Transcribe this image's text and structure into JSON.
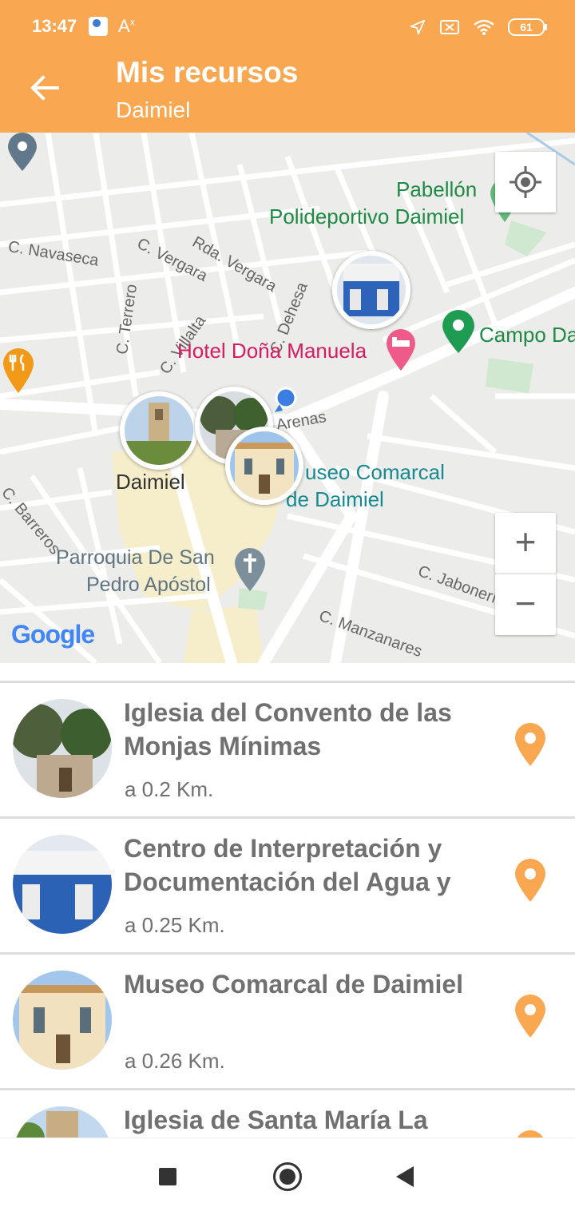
{
  "status_bar": {
    "time": "13:47",
    "accessibility_glyph": "A",
    "accessibility_sup": "x",
    "battery": "61"
  },
  "header": {
    "title": "Mis recursos",
    "subtitle": "Daimiel"
  },
  "colors": {
    "accent": "#F9A750",
    "green_poi": "#1e8a44",
    "pink_poi": "#d81b60",
    "teal_poi": "#168a90",
    "grey_poi": "#5f7380",
    "user_dot": "#3b7de0"
  },
  "map": {
    "streets": {
      "navaseca": "C. Navaseca",
      "vergara": "C. Vergara",
      "rda_vergara": "Rda. Vergara",
      "terrero": "C. Terrero",
      "villalta": "C. Villalta",
      "dehesa": "C. Dehesa",
      "arenas": "Arenas",
      "barreros": "C. Barreros",
      "jaboneria": "C. Jabonería",
      "manzanares": "C. Manzanares"
    },
    "pois": {
      "pabellon_1": "Pabellón",
      "pabellon_2": "Polideportivo Daimiel",
      "campo": "Campo Da",
      "hotel": "Hotel Doña Manuela",
      "museo_1": "useo Comarcal",
      "museo_2": "de Daimiel",
      "parroquia_1": "Parroquia De San",
      "parroquia_2": "Pedro Apóstol",
      "city": "Daimiel"
    },
    "zoom_in": "+",
    "zoom_out": "−",
    "attribution": "Google"
  },
  "resources": [
    {
      "name": "Iglesia del Convento de las Monjas Mínimas",
      "distance": "a 0.2 Km.",
      "icon": "map-pin-icon"
    },
    {
      "name": "Centro de Interpretación y Documentación del Agua y los Humedales Manchegos",
      "distance": "a 0.25 Km.",
      "icon": "map-pin-icon"
    },
    {
      "name": "Museo Comarcal de Daimiel",
      "distance": "a 0.26 Km.",
      "icon": "map-pin-icon"
    },
    {
      "name": "Iglesia de Santa María La",
      "distance": "",
      "icon": "map-pin-icon"
    }
  ]
}
